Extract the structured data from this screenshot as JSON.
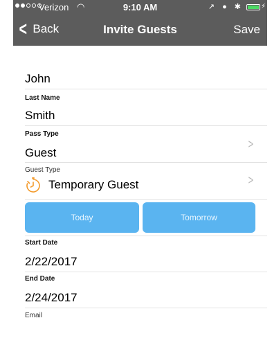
{
  "status_bar": {
    "carrier": "Verizon",
    "wifi_glyph": "◠",
    "time": "9:10 AM",
    "icons_text": "↗ ● ✱"
  },
  "nav": {
    "back_label": "Back",
    "title": "Invite Guests",
    "save_label": "Save"
  },
  "form": {
    "first_name": {
      "value": "John"
    },
    "last_name": {
      "label": "Last Name",
      "value": "Smith"
    },
    "pass_type": {
      "label": "Pass Type",
      "value": "Guest"
    },
    "guest_type": {
      "label": "Guest Type",
      "value": "Temporary Guest",
      "icon": "stopwatch-icon"
    },
    "quick_dates": {
      "today_label": "Today",
      "tomorrow_label": "Tomorrow"
    },
    "start_date": {
      "label": "Start Date",
      "value": "2/22/2017"
    },
    "end_date": {
      "label": "End Date",
      "value": "2/24/2017"
    },
    "email": {
      "label": "Email"
    }
  },
  "colors": {
    "nav_bar": "#5c5c5c",
    "button": "#5ab4f0",
    "icon_accent": "#f39a2b",
    "battery": "#4cd964"
  }
}
